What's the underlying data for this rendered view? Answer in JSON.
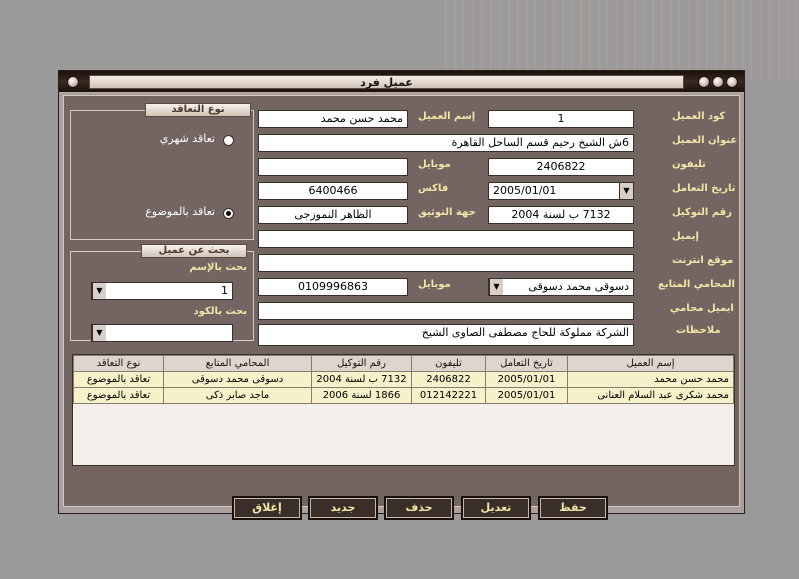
{
  "window": {
    "title": "عميل فرد"
  },
  "labels": {
    "client_code": "كود العميل",
    "client_name": "إسم العميل",
    "client_address": "عنوان العميل",
    "phone": "تليفون",
    "mobile": "موبايل",
    "deal_date": "تاريخ التعامل",
    "fax": "فاكس",
    "power_no": "رقم التوكيل",
    "power_authority": "جهة التوثيق",
    "email": "إيميل",
    "website": "موقع انترنت",
    "lawyer": "المحامي المتابع",
    "lawyer_mobile": "موبايل",
    "lawyer_email": "ايميل محامي",
    "notes": "ملاحظات"
  },
  "fields": {
    "client_code": "1",
    "client_name": "محمد حسن محمد",
    "client_address": "6ش الشيخ رحيم قسم الساحل القاهرة",
    "phone": "2406822",
    "mobile": "",
    "deal_date": "2005/01/01",
    "fax": "6400466",
    "power_no": "7132 ب لسنة 2004",
    "power_authority": "الظاهر النموزجى",
    "email": "",
    "website": "",
    "lawyer": "دسوقى محمد دسوقى",
    "lawyer_mobile": "0109996863",
    "lawyer_email": "",
    "notes": "الشركة مملوكة للحاج مصطفى الصاوى الشيخ"
  },
  "contract_group": {
    "title": "نوع التعاقد",
    "options": [
      {
        "label": "تعاقد شهري",
        "selected": false
      },
      {
        "label": "تعاقد بالموضوع",
        "selected": true
      }
    ]
  },
  "search_group": {
    "title": "بحث عن عميل",
    "by_name_label": "بحث بالإسم",
    "by_name_value": "1",
    "by_code_label": "بحث بالكود",
    "by_code_value": ""
  },
  "grid": {
    "columns": [
      "إسم العميل",
      "تاريخ التعامل",
      "تليفون",
      "رقم التوكيل",
      "المحامي المتابع",
      "نوع التعاقد"
    ],
    "rows": [
      [
        "محمد حسن محمد",
        "2005/01/01",
        "2406822",
        "7132 ب لسنة 2004",
        "دسوقى محمد دسوقى",
        "تعاقد بالموضوع"
      ],
      [
        "محمد شكرى عبد السلام العنانى",
        "2005/01/01",
        "012142221",
        "1866 لسنة 2006",
        "ماجد صابر ذكى",
        "تعاقد بالموضوع"
      ]
    ]
  },
  "buttons": {
    "save": "حفظ",
    "edit": "تعديل",
    "delete": "حذف",
    "new": "جديد",
    "close": "إغلاق"
  }
}
